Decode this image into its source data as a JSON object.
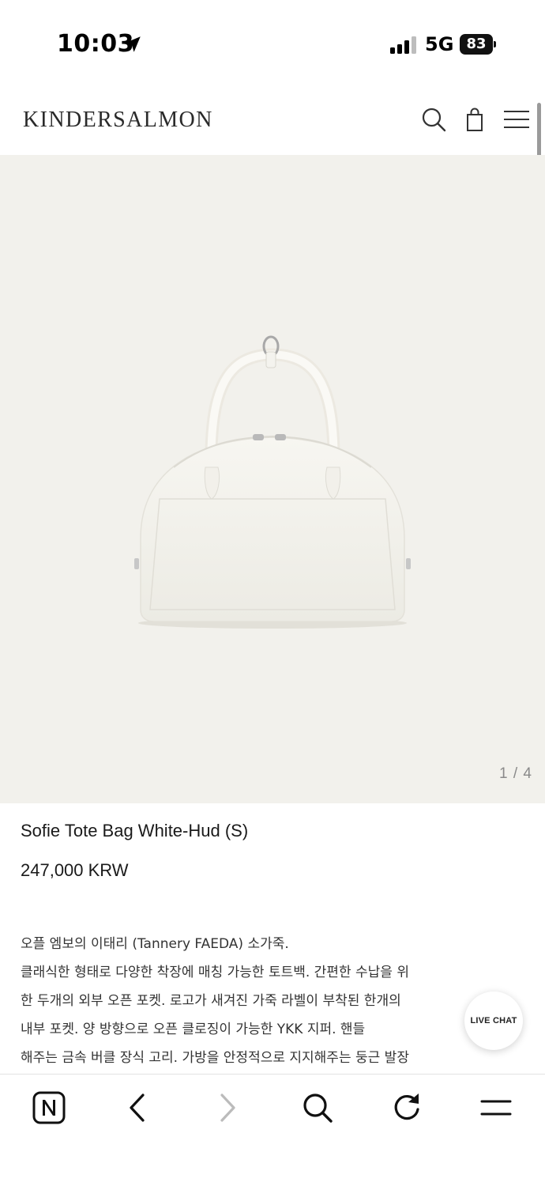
{
  "status_bar": {
    "time": "10:03",
    "network": "5G",
    "battery": "83"
  },
  "header": {
    "logo": "KINDERSALMON",
    "icons": [
      "search-icon",
      "shopping-bag-icon",
      "menu-icon"
    ]
  },
  "gallery": {
    "counter": "1 / 4",
    "background_color": "#f2f1ec"
  },
  "product": {
    "name": "Sofie Tote Bag White-Hud (S)",
    "price": "247,000 KRW",
    "description_lines": [
      "오플 엠보의 이태리 (Tannery FAEDA) 소가죽.",
      "클래식한 형태로 다양한 착장에 매칭 가능한 토트백. 간편한 수납을 위",
      "한 두개의 외부 오픈 포켓. 로고가 새겨진 가죽 라벨이 부착된 한개의",
      "내부 포켓. 양 방향으로 오픈 클로징이 가능한 YKK 지퍼. 핸들",
      "해주는 금속 버클 장식 고리. 가방을 안정적으로 지지해주는 둥근 발장"
    ]
  },
  "live_chat": {
    "label": "LIVE CHAT"
  },
  "browser_toolbar": {
    "icons": [
      "n-logo-icon",
      "back-icon",
      "forward-icon",
      "search-icon",
      "reload-icon",
      "menu-icon"
    ]
  }
}
